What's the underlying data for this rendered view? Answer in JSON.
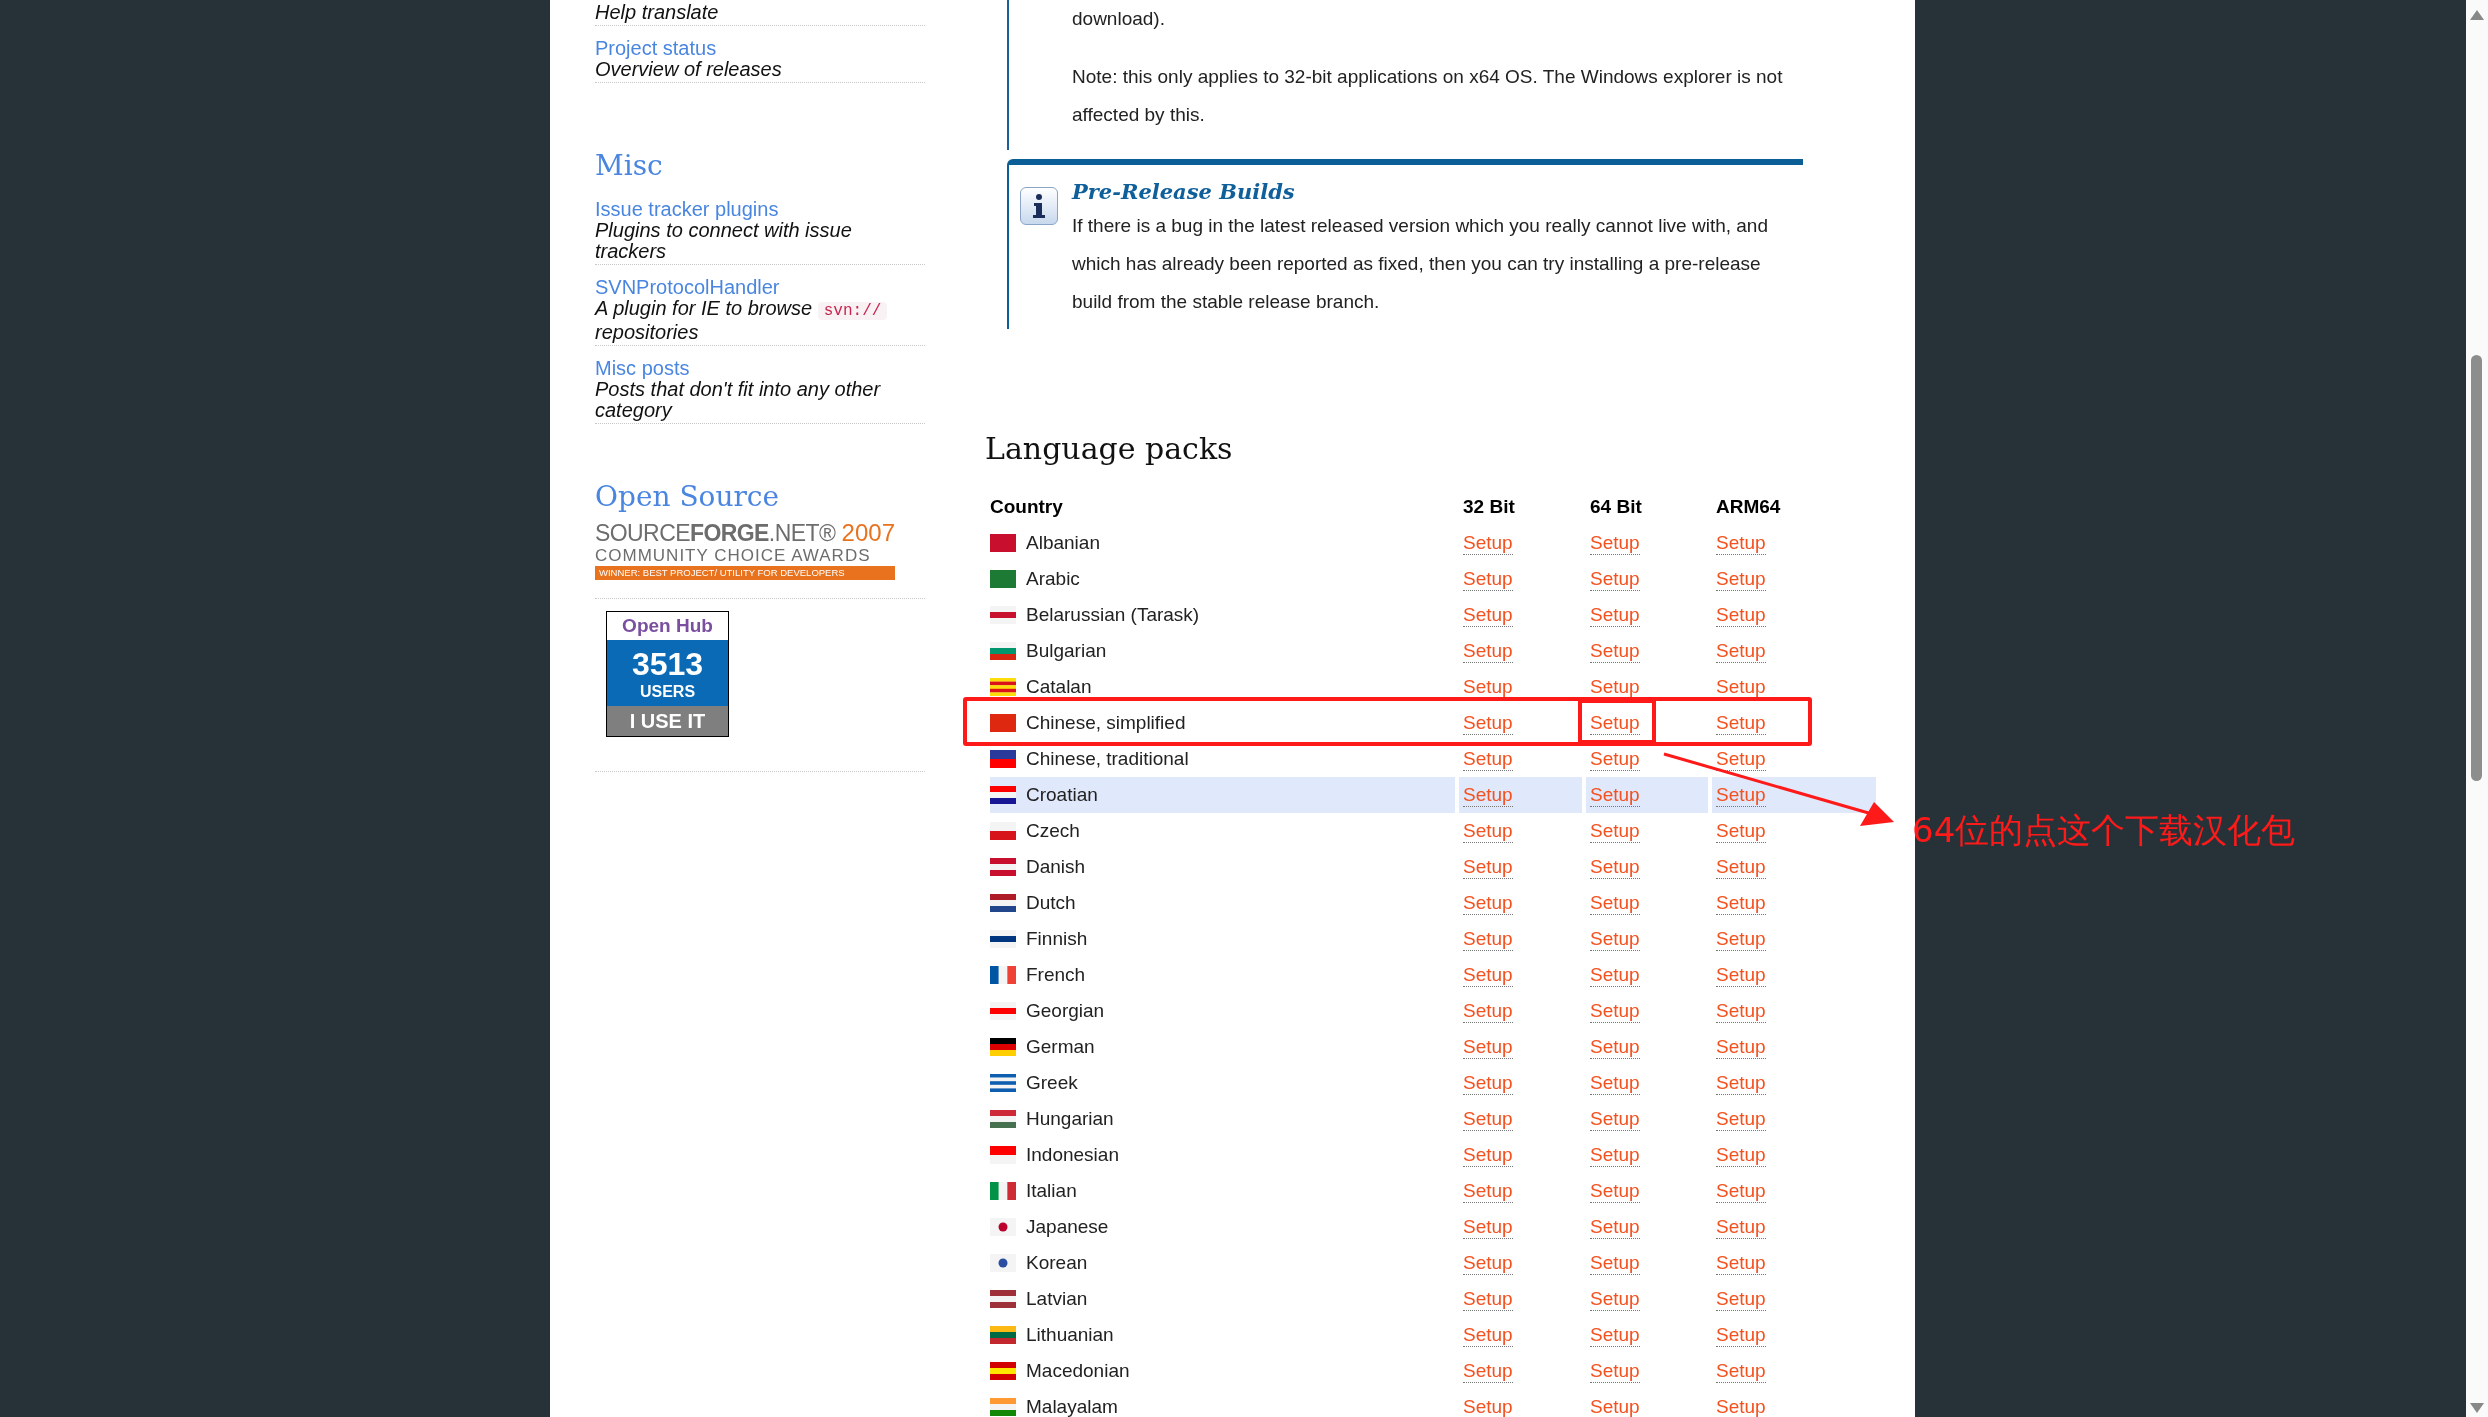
{
  "sidebar": {
    "top_items": [
      {
        "description": "Help translate"
      },
      {
        "title": "Project status",
        "description": "Overview of releases"
      }
    ],
    "sections": [
      {
        "heading": "Misc",
        "items": [
          {
            "title": "Issue tracker plugins",
            "description": "Plugins to connect with issue trackers"
          },
          {
            "title": "SVNProtocolHandler",
            "description": "A plugin for IE to browse",
            "code": "svn://",
            "description_after": "repositories"
          },
          {
            "title": "Misc posts",
            "description": "Posts that don't fit into any other category"
          }
        ]
      }
    ],
    "open_source": {
      "heading": "Open Source",
      "award": {
        "brand": "SOURCE**FORGE**.NET®",
        "year": "2007",
        "line2": "COMMUNITY CHOICE AWARDS",
        "banner": "WINNER: BEST PROJECT/ UTILITY FOR DEVELOPERS"
      },
      "badge": {
        "brand": "Open Hub",
        "count": "3513",
        "unit": "USERS",
        "action": "I USE IT"
      }
    }
  },
  "content": {
    "paragraphs": [
      "download).",
      "Note: this only applies to 32-bit applications on x64 OS. The Windows explorer is not affected by this."
    ],
    "info_box": {
      "title": "Pre-Release Builds",
      "text": "If there is a bug in the latest released version which you really cannot live with, and which has already been reported as fixed, then you can try installing a pre-release build from the stable release branch."
    },
    "language_packs": {
      "heading": "Language packs",
      "columns": [
        "Country",
        "32 Bit",
        "64 Bit",
        "ARM64"
      ],
      "rows": [
        {
          "name": "Albanian",
          "highlighted": false,
          "boxed": false,
          "links": [
            {
              "label": "Setup",
              "boxed": false
            },
            {
              "label": "Setup",
              "boxed": false
            },
            {
              "label": "Setup",
              "boxed": false
            }
          ]
        },
        {
          "name": "Arabic",
          "highlighted": false,
          "boxed": false,
          "links": [
            {
              "label": "Setup",
              "boxed": false
            },
            {
              "label": "Setup",
              "boxed": false
            },
            {
              "label": "Setup",
              "boxed": false
            }
          ]
        },
        {
          "name": "Belarussian (Tarask)",
          "highlighted": false,
          "boxed": false,
          "links": [
            {
              "label": "Setup",
              "boxed": false
            },
            {
              "label": "Setup",
              "boxed": false
            },
            {
              "label": "Setup",
              "boxed": false
            }
          ]
        },
        {
          "name": "Bulgarian",
          "highlighted": false,
          "boxed": false,
          "links": [
            {
              "label": "Setup",
              "boxed": false
            },
            {
              "label": "Setup",
              "boxed": false
            },
            {
              "label": "Setup",
              "boxed": false
            }
          ]
        },
        {
          "name": "Catalan",
          "highlighted": false,
          "boxed": false,
          "links": [
            {
              "label": "Setup",
              "boxed": false
            },
            {
              "label": "Setup",
              "boxed": false
            },
            {
              "label": "Setup",
              "boxed": false
            }
          ]
        },
        {
          "name": "Chinese, simplified",
          "highlighted": false,
          "boxed": true,
          "links": [
            {
              "label": "Setup",
              "boxed": false
            },
            {
              "label": "Setup",
              "boxed": true
            },
            {
              "label": "Setup",
              "boxed": false
            }
          ]
        },
        {
          "name": "Chinese, traditional",
          "highlighted": false,
          "boxed": false,
          "links": [
            {
              "label": "Setup",
              "boxed": false
            },
            {
              "label": "Setup",
              "boxed": false
            },
            {
              "label": "Setup",
              "boxed": false
            }
          ]
        },
        {
          "name": "Croatian",
          "highlighted": true,
          "boxed": false,
          "links": [
            {
              "label": "Setup",
              "boxed": false
            },
            {
              "label": "Setup",
              "boxed": false
            },
            {
              "label": "Setup",
              "boxed": false
            }
          ]
        },
        {
          "name": "Czech",
          "highlighted": false,
          "boxed": false,
          "links": [
            {
              "label": "Setup",
              "boxed": false
            },
            {
              "label": "Setup",
              "boxed": false
            },
            {
              "label": "Setup",
              "boxed": false
            }
          ]
        },
        {
          "name": "Danish",
          "highlighted": false,
          "boxed": false,
          "links": [
            {
              "label": "Setup",
              "boxed": false
            },
            {
              "label": "Setup",
              "boxed": false
            },
            {
              "label": "Setup",
              "boxed": false
            }
          ]
        },
        {
          "name": "Dutch",
          "highlighted": false,
          "boxed": false,
          "links": [
            {
              "label": "Setup",
              "boxed": false
            },
            {
              "label": "Setup",
              "boxed": false
            },
            {
              "label": "Setup",
              "boxed": false
            }
          ]
        },
        {
          "name": "Finnish",
          "highlighted": false,
          "boxed": false,
          "links": [
            {
              "label": "Setup",
              "boxed": false
            },
            {
              "label": "Setup",
              "boxed": false
            },
            {
              "label": "Setup",
              "boxed": false
            }
          ]
        },
        {
          "name": "French",
          "highlighted": false,
          "boxed": false,
          "links": [
            {
              "label": "Setup",
              "boxed": false
            },
            {
              "label": "Setup",
              "boxed": false
            },
            {
              "label": "Setup",
              "boxed": false
            }
          ]
        },
        {
          "name": "Georgian",
          "highlighted": false,
          "boxed": false,
          "links": [
            {
              "label": "Setup",
              "boxed": false
            },
            {
              "label": "Setup",
              "boxed": false
            },
            {
              "label": "Setup",
              "boxed": false
            }
          ]
        },
        {
          "name": "German",
          "highlighted": false,
          "boxed": false,
          "links": [
            {
              "label": "Setup",
              "boxed": false
            },
            {
              "label": "Setup",
              "boxed": false
            },
            {
              "label": "Setup",
              "boxed": false
            }
          ]
        },
        {
          "name": "Greek",
          "highlighted": false,
          "boxed": false,
          "links": [
            {
              "label": "Setup",
              "boxed": false
            },
            {
              "label": "Setup",
              "boxed": false
            },
            {
              "label": "Setup",
              "boxed": false
            }
          ]
        },
        {
          "name": "Hungarian",
          "highlighted": false,
          "boxed": false,
          "links": [
            {
              "label": "Setup",
              "boxed": false
            },
            {
              "label": "Setup",
              "boxed": false
            },
            {
              "label": "Setup",
              "boxed": false
            }
          ]
        },
        {
          "name": "Indonesian",
          "highlighted": false,
          "boxed": false,
          "links": [
            {
              "label": "Setup",
              "boxed": false
            },
            {
              "label": "Setup",
              "boxed": false
            },
            {
              "label": "Setup",
              "boxed": false
            }
          ]
        },
        {
          "name": "Italian",
          "highlighted": false,
          "boxed": false,
          "links": [
            {
              "label": "Setup",
              "boxed": false
            },
            {
              "label": "Setup",
              "boxed": false
            },
            {
              "label": "Setup",
              "boxed": false
            }
          ]
        },
        {
          "name": "Japanese",
          "highlighted": false,
          "boxed": false,
          "links": [
            {
              "label": "Setup",
              "boxed": false
            },
            {
              "label": "Setup",
              "boxed": false
            },
            {
              "label": "Setup",
              "boxed": false
            }
          ]
        },
        {
          "name": "Korean",
          "highlighted": false,
          "boxed": false,
          "links": [
            {
              "label": "Setup",
              "boxed": false
            },
            {
              "label": "Setup",
              "boxed": false
            },
            {
              "label": "Setup",
              "boxed": false
            }
          ]
        },
        {
          "name": "Latvian",
          "highlighted": false,
          "boxed": false,
          "links": [
            {
              "label": "Setup",
              "boxed": false
            },
            {
              "label": "Setup",
              "boxed": false
            },
            {
              "label": "Setup",
              "boxed": false
            }
          ]
        },
        {
          "name": "Lithuanian",
          "highlighted": false,
          "boxed": false,
          "links": [
            {
              "label": "Setup",
              "boxed": false
            },
            {
              "label": "Setup",
              "boxed": false
            },
            {
              "label": "Setup",
              "boxed": false
            }
          ]
        },
        {
          "name": "Macedonian",
          "highlighted": false,
          "boxed": false,
          "links": [
            {
              "label": "Setup",
              "boxed": false
            },
            {
              "label": "Setup",
              "boxed": false
            },
            {
              "label": "Setup",
              "boxed": false
            }
          ]
        },
        {
          "name": "Malayalam",
          "highlighted": false,
          "boxed": false,
          "links": [
            {
              "label": "Setup",
              "boxed": false
            },
            {
              "label": "Setup",
              "boxed": false
            },
            {
              "label": "Setup",
              "boxed": false
            }
          ]
        }
      ]
    }
  },
  "annotation": {
    "text": "64位的点这个下载汉化包"
  }
}
